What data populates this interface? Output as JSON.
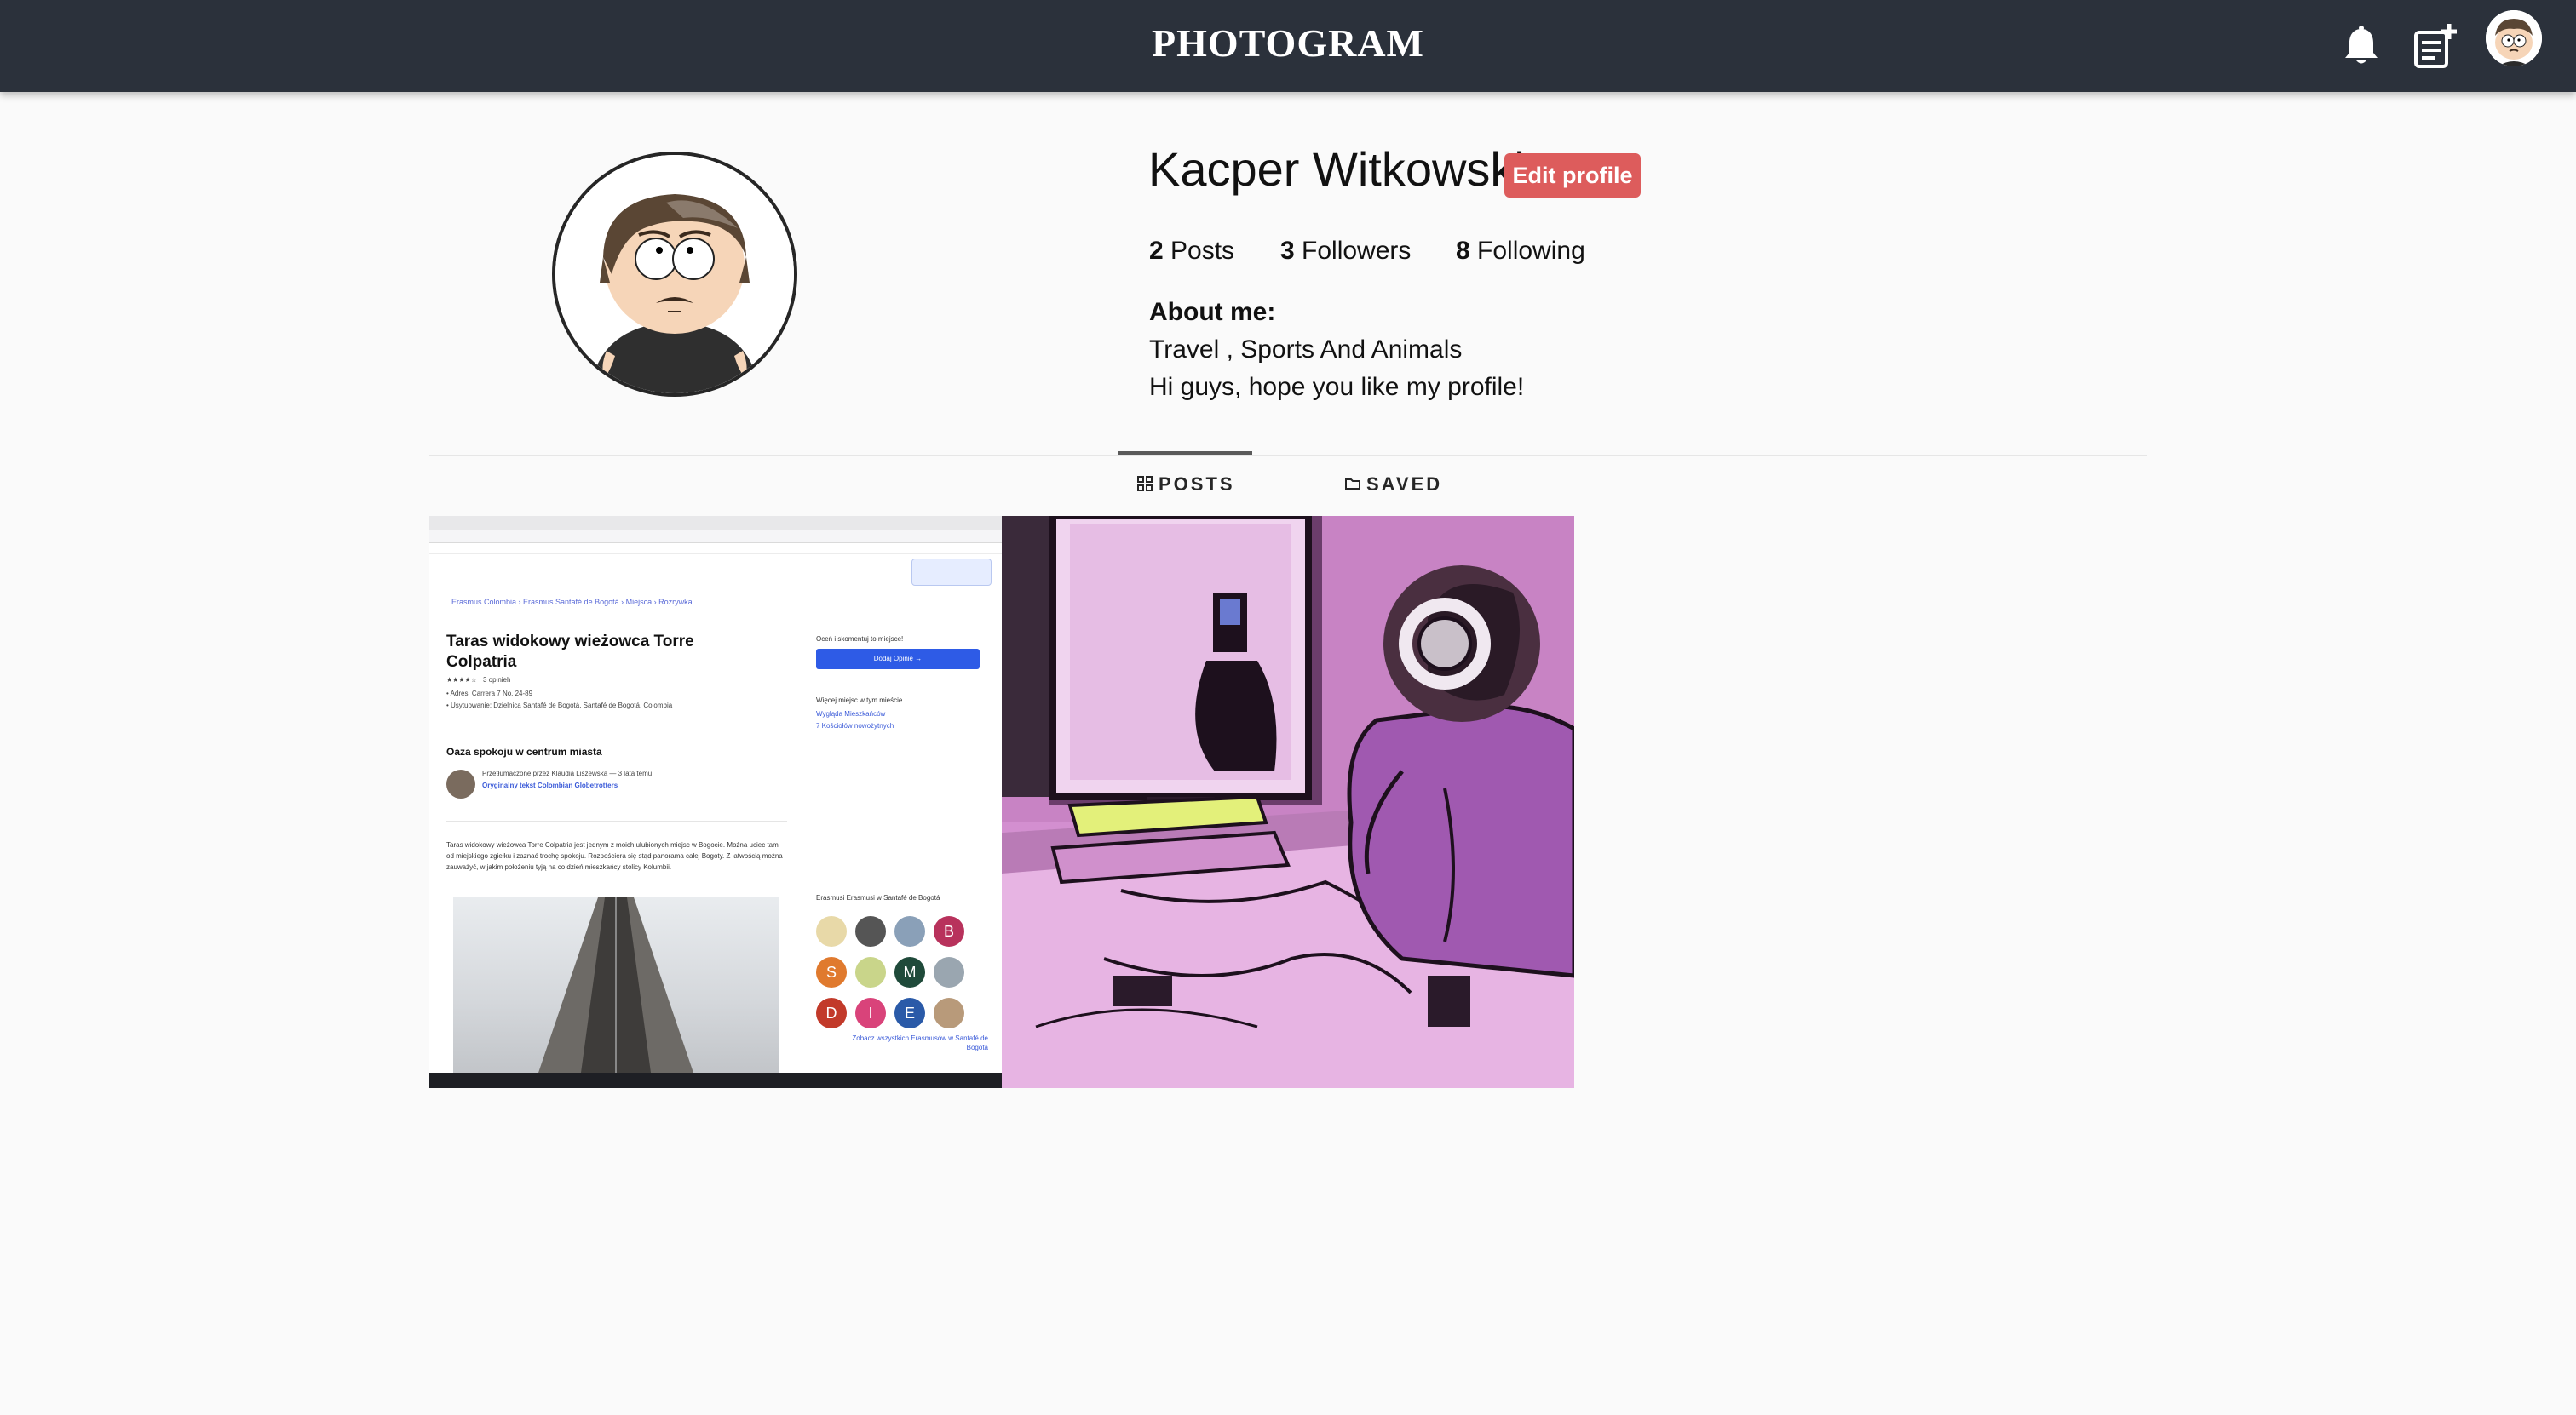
{
  "navbar": {
    "brand": "PHOTOGRAM",
    "icons": [
      "bell-icon",
      "new-post-icon",
      "user-avatar"
    ]
  },
  "profile": {
    "username": "Kacper Witkowski",
    "edit_label": "Edit profile",
    "stats": {
      "posts_count": "2",
      "posts_label": "Posts",
      "followers_count": "3",
      "followers_label": "Followers",
      "following_count": "8",
      "following_label": "Following"
    },
    "about_title": "About me:",
    "about_line1": "Travel , Sports And Animals",
    "about_line2": "Hi guys, hope you like my profile!"
  },
  "tabs": {
    "posts_label": "POSTS",
    "saved_label": "SAVED",
    "active": "POSTS"
  },
  "posts": {
    "post1": {
      "crumb": "Erasmus Colombia  ›  Erasmus Santafé de Bogotá  ›  Miejsca  ›  Rozrywka",
      "title": "Taras widokowy wieżowca Torre Colpatria",
      "meta1": "★★★★☆  · 3 opinieh",
      "meta2": "•  Adres: Carrera 7 No. 24-89",
      "meta3": "•  Usytuowanie: Dzielnica Santafé de Bogotá, Santafé de Bogotá, Colombia",
      "h2": "Oaza spokoju w centrum miasta",
      "author": "Przetłumaczone przez  Klaudia Liszewska — 3 lata temu",
      "author2": "Oryginalny tekst  Colombian Globetrotters",
      "body": "Taras widokowy wieżowca Torre Colpatria jest jednym z moich ulubionych miejsc w Bogocie. Można uciec tam od miejskiego zgiełku i zaznać trochę spokoju. Rozpościera się stąd panorama całej Bogoty. Z łatwością można zauważyć, w jakim położeniu tyją na co dzień mieszkańcy stolicy Kolumbii.",
      "right_label1": "Oceń i skomentuj to miejsce!",
      "button": "Dodaj Opinię →",
      "right_label2": "Więcej miejsc w tym mieście",
      "link1": "Wygląda Mieszkańców",
      "link2": "7 Kościołów nowożytnych",
      "right_label3": "Erasmusi Erasmusi w Santafé de Bogotá",
      "avatar_letters": [
        "B",
        "S",
        "M",
        "D",
        "I",
        "E"
      ],
      "more_link": "Zobacz wszystkich Erasmusów w Santafé de Bogotá"
    }
  },
  "colors": {
    "navbar": "#2b313b",
    "edit_button": "#dd5c5c",
    "background": "#fafafa"
  }
}
